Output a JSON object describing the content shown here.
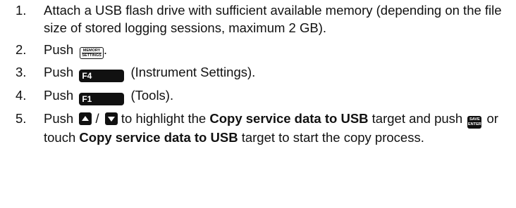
{
  "steps": [
    {
      "number": "1.",
      "text": "Attach a USB flash drive with sufficient available memory (depending on the file size of stored logging sessions, maximum 2 GB)."
    },
    {
      "number": "2.",
      "prefix": "Push",
      "suffix": ".",
      "key": {
        "icon": "memory-settings-key-icon",
        "line1": "MEMORY",
        "line2": "SETTINGS"
      }
    },
    {
      "number": "3.",
      "prefix": "Push",
      "key_label": "F4",
      "suffix": "(Instrument Settings)."
    },
    {
      "number": "4.",
      "prefix": "Push",
      "key_label": "F1",
      "suffix": "(Tools)."
    },
    {
      "number": "5.",
      "prefix": "Push",
      "sep": "/",
      "t1": "to highlight the",
      "bold1": "Copy service data to USB",
      "t2": "target and push",
      "save_line1": "SAVE",
      "save_line2": "ENTER",
      "t3": "or touch",
      "bold2": "Copy service data to USB",
      "t4": "target to start the copy process.",
      "up_icon": "up-arrow-key-icon",
      "down_icon": "down-arrow-key-icon",
      "save_icon": "save-enter-key-icon"
    }
  ]
}
